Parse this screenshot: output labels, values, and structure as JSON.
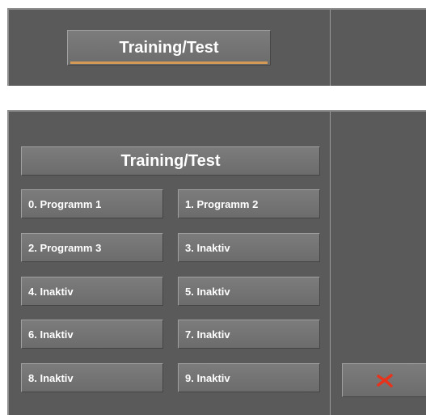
{
  "top_panel": {
    "mode_button_label": "Training/Test"
  },
  "program_panel": {
    "title": "Training/Test",
    "programs": [
      "0. Programm 1",
      "1. Programm 2",
      "2. Programm 3",
      "3. Inaktiv",
      "4. Inaktiv",
      "5. Inaktiv",
      "6. Inaktiv",
      "7. Inaktiv",
      "8. Inaktiv",
      "9. Inaktiv"
    ]
  },
  "close_button": {
    "icon": "close-icon",
    "color": "#e8331c"
  },
  "colors": {
    "accent": "#d49a55",
    "panel": "#5a5a5a",
    "button": "#747474"
  }
}
